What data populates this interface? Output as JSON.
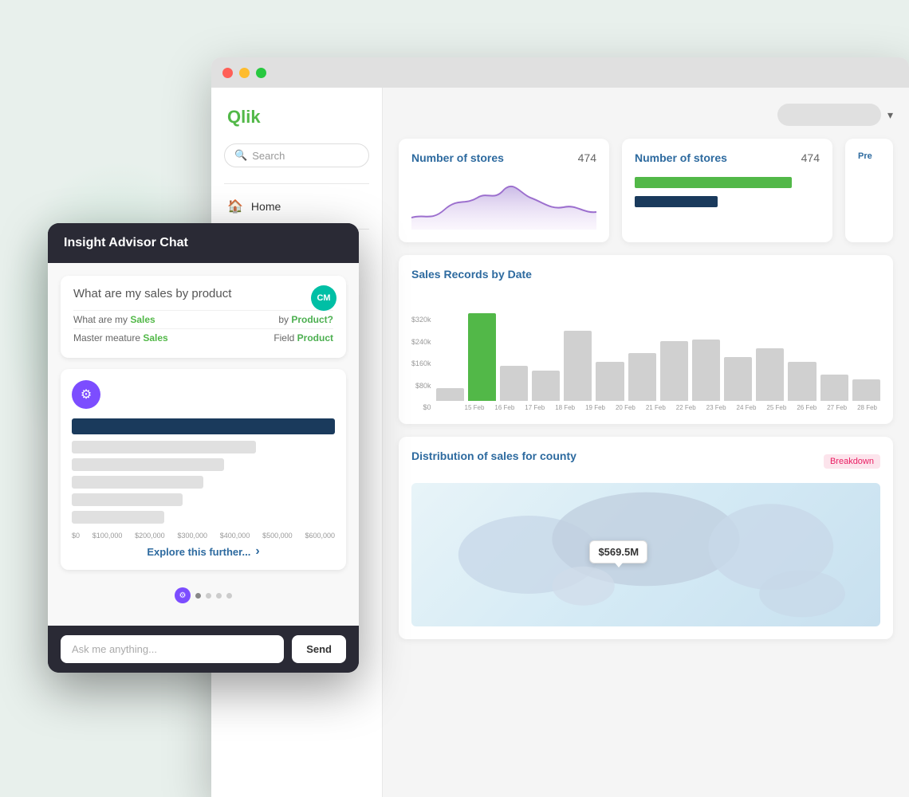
{
  "app": {
    "title": "Qlik",
    "window": {
      "dots": [
        "red",
        "yellow",
        "green"
      ]
    }
  },
  "sidebar": {
    "search_placeholder": "Search",
    "nav_items": [
      {
        "label": "Home",
        "icon": "🏠"
      }
    ],
    "placeholder_lines": [
      2
    ]
  },
  "header": {
    "search_pill": "",
    "chevron": "▾"
  },
  "cards": [
    {
      "id": "card1",
      "title": "Number of stores",
      "value": "474",
      "type": "area"
    },
    {
      "id": "card2",
      "title": "Number of stores",
      "value": "474",
      "type": "hbar"
    }
  ],
  "sales_chart": {
    "title": "Sales Records by Date",
    "y_labels": [
      "$320k",
      "$240k",
      "$160k",
      "$80k",
      "$0"
    ],
    "x_labels": [
      "15 Feb",
      "16 Feb",
      "17 Feb",
      "18 Feb",
      "19 Feb",
      "20 Feb",
      "21 Feb",
      "22 Feb",
      "23 Feb",
      "24 Feb",
      "25 Feb",
      "26 Feb",
      "27 Feb",
      "28 Feb"
    ],
    "bars": [
      {
        "height": 15,
        "type": "gray"
      },
      {
        "height": 100,
        "type": "green"
      },
      {
        "height": 40,
        "type": "gray"
      },
      {
        "height": 35,
        "type": "gray"
      },
      {
        "height": 80,
        "type": "gray"
      },
      {
        "height": 45,
        "type": "gray"
      },
      {
        "height": 55,
        "type": "gray"
      },
      {
        "height": 68,
        "type": "gray"
      },
      {
        "height": 70,
        "type": "gray"
      },
      {
        "height": 50,
        "type": "gray"
      },
      {
        "height": 60,
        "type": "gray"
      },
      {
        "height": 45,
        "type": "gray"
      },
      {
        "height": 30,
        "type": "gray"
      },
      {
        "height": 25,
        "type": "gray"
      }
    ]
  },
  "map_card": {
    "title": "Distribution of sales for county",
    "badge": "Breakdown",
    "tooltip_value": "$569.5M"
  },
  "chat": {
    "title": "Insight Advisor Chat",
    "query_text": "What are my sales by product",
    "avatar_initials": "CM",
    "parse_rows": [
      {
        "left": "What are my",
        "left_keyword": "Sales",
        "right": "by",
        "right_keyword": "Product?"
      },
      {
        "left": "Master meature",
        "left_keyword": "Sales",
        "right": "Field",
        "right_keyword": "Product"
      }
    ],
    "explore_label": "Explore this further...",
    "bar_labels": [
      "$0",
      "$100,000",
      "$200,000",
      "$300,000",
      "$400,000",
      "$500,000",
      "$600,000"
    ],
    "input_placeholder": "Ask me anything...",
    "send_label": "Send",
    "pre_label": "Pre"
  }
}
